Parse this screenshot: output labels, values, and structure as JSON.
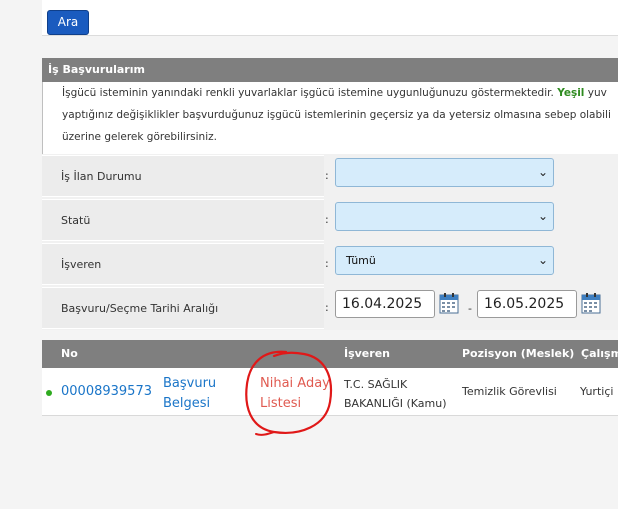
{
  "toolbar": {
    "search_button": "Ara"
  },
  "panel": {
    "title": "İş Başvurularım",
    "info_line1_a": "İşgücü isteminin yanındaki renkli yuvarlaklar işgücü istemine uygunluğunuzu göstermektedir.",
    "info_line1_green": "Yeşil",
    "info_line1_b": "yuv",
    "info_line2": "yaptığınız değişiklikler başvurduğunuz işgücü istemlerinin geçersiz ya da yetersiz olmasına sebep olabili",
    "info_line3": "üzerine gelerek görebilirsiniz."
  },
  "filters": {
    "colon": ":",
    "is_ilan_durumu_label": "İş İlan Durumu",
    "is_ilan_durumu_value": "",
    "statu_label": "Statü",
    "statu_value": "",
    "isveren_label": "İşveren",
    "isveren_value": "Tümü",
    "tarih_label": "Başvuru/Seçme Tarihi Aralığı",
    "tarih_start": "16.04.2025",
    "tarih_separator": "-",
    "tarih_end": "16.05.2025"
  },
  "table": {
    "headers": {
      "no": "No",
      "isveren": "İşveren",
      "pozisyon": "Pozisyon (Meslek)",
      "calisma": "Çalışm"
    },
    "rows": [
      {
        "no": "00008939573",
        "belge_line1": "Başvuru",
        "belge_line2": "Belgesi",
        "aday_line1": "Nihai Aday",
        "aday_line2": "Listesi",
        "isveren_line1": "T.C. SAĞLIK",
        "isveren_line2": "BAKANLIĞI (Kamu)",
        "pozisyon": "Temizlik Görevlisi",
        "calisma": "Yurtiçi"
      }
    ]
  },
  "colors": {
    "accent_blue": "#1a5bbf",
    "header_gray": "#7f7f7f",
    "status_green": "#2eaa1f",
    "annotation_red": "#e01818"
  }
}
